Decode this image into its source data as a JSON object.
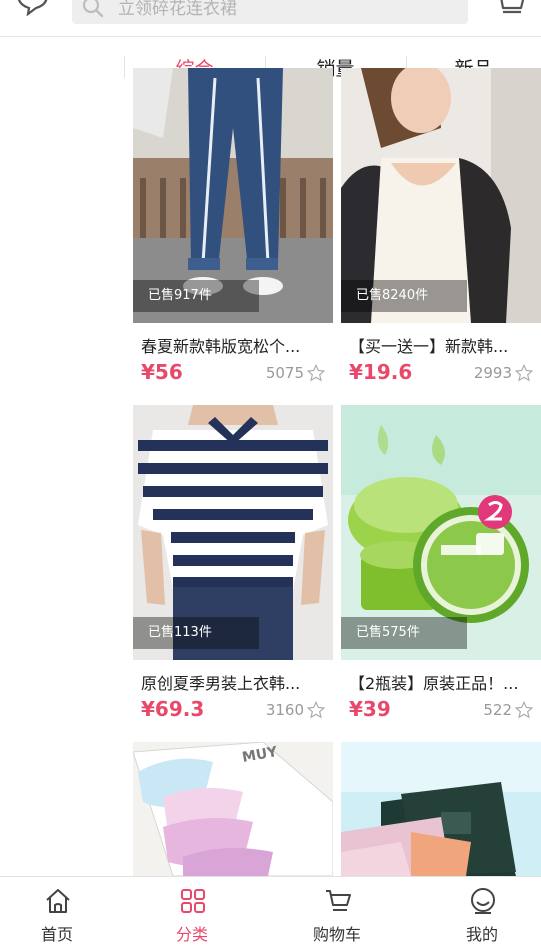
{
  "header": {
    "search_placeholder": "立领碎花连衣裙"
  },
  "sort_tabs": [
    {
      "label": "综合",
      "active": true
    },
    {
      "label": "销量",
      "active": false
    },
    {
      "label": "新品",
      "active": false
    }
  ],
  "products": [
    {
      "sold": "已售917件",
      "title": "春夏新款韩版宽松个...",
      "price": "¥56",
      "favorites": "5075"
    },
    {
      "sold": "已售8240件",
      "title": "【买一送一】新款韩...",
      "price": "¥19.6",
      "favorites": "2993"
    },
    {
      "sold": "已售113件",
      "title": "原创夏季男装上衣韩...",
      "price": "¥69.3",
      "favorites": "3160"
    },
    {
      "sold": "已售575件",
      "title": "【2瓶装】原装正品！...",
      "price": "¥39",
      "favorites": "522"
    }
  ],
  "bottom_nav": [
    {
      "label": "首页",
      "icon": "home-icon",
      "active": false
    },
    {
      "label": "分类",
      "icon": "category-grid-icon",
      "active": true
    },
    {
      "label": "购物车",
      "icon": "cart-icon",
      "active": false
    },
    {
      "label": "我的",
      "icon": "profile-smile-icon",
      "active": false
    }
  ],
  "colors": {
    "accent": "#e8496b",
    "muted": "#999999"
  }
}
